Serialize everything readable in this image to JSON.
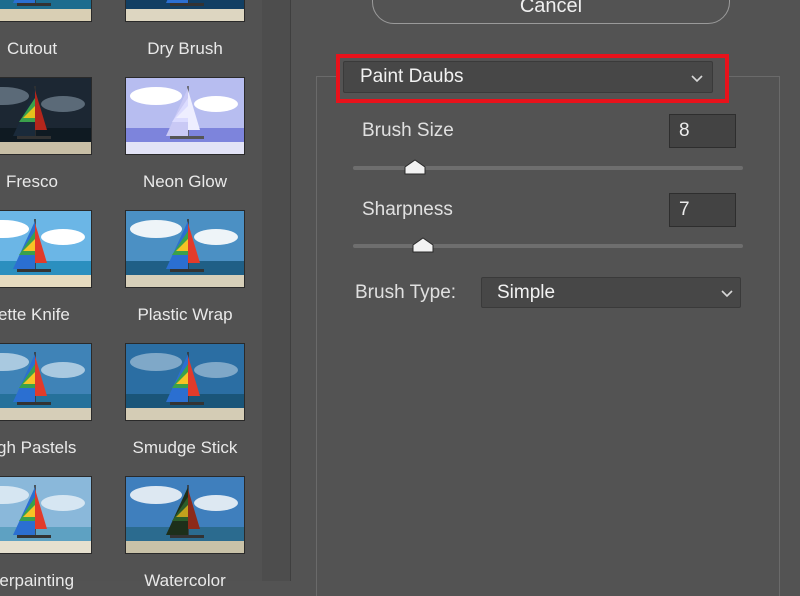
{
  "gallery": {
    "items": [
      {
        "label": "Cutout",
        "style": "cutout"
      },
      {
        "label": "Dry Brush",
        "style": "drybrush"
      },
      {
        "label": "Fresco",
        "style": "fresco"
      },
      {
        "label": "Neon Glow",
        "style": "neon"
      },
      {
        "label": "lette Knife",
        "style": "knife"
      },
      {
        "label": "Plastic Wrap",
        "style": "plastic"
      },
      {
        "label": "ugh Pastels",
        "style": "pastels"
      },
      {
        "label": "Smudge Stick",
        "style": "smudge"
      },
      {
        "label": "derpainting",
        "style": "underpaint"
      },
      {
        "label": "Watercolor",
        "style": "watercolor"
      }
    ]
  },
  "dialog": {
    "cancel_label": "Cancel",
    "filter_select_value": "Paint Daubs",
    "brush_size": {
      "label": "Brush Size",
      "value": "8",
      "fraction": 0.16
    },
    "sharpness": {
      "label": "Sharpness",
      "value": "7",
      "fraction": 0.18
    },
    "brush_type": {
      "label": "Brush Type:",
      "value": "Simple"
    }
  },
  "colors": {
    "panel_bg": "#535353",
    "highlight": "#e8121b",
    "field_bg": "#434343"
  }
}
